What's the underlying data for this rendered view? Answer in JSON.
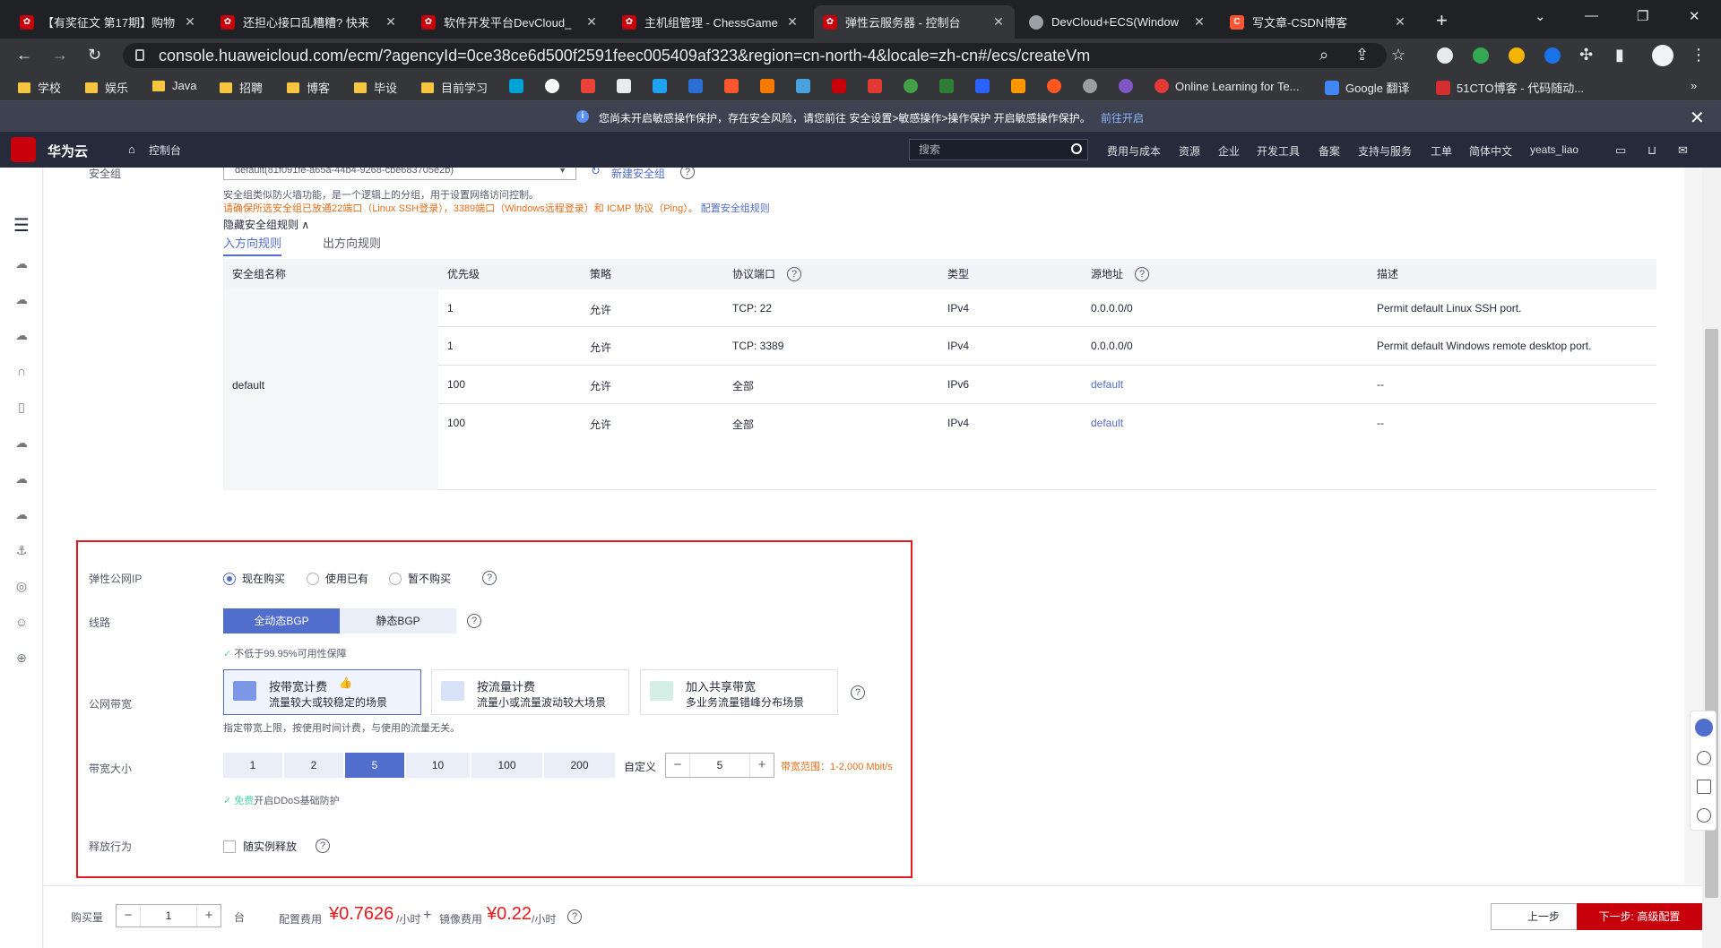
{
  "browser": {
    "tabs": [
      {
        "title": "【有奖征文 第17期】购物",
        "color": "#c7000b",
        "active": false
      },
      {
        "title": "还担心接口乱糟糟? 快来",
        "color": "#c7000b",
        "active": false
      },
      {
        "title": "软件开发平台DevCloud_",
        "color": "#c7000b",
        "active": false
      },
      {
        "title": "主机组管理 - ChessGame",
        "color": "#c7000b",
        "active": false
      },
      {
        "title": "弹性云服务器 - 控制台",
        "color": "#c7000b",
        "active": true
      },
      {
        "title": "DevCloud+ECS(Window",
        "color": "#9aa0a6",
        "active": false
      },
      {
        "title": "写文章-CSDN博客",
        "color": "#fc5531",
        "active": false
      }
    ],
    "url": "console.huaweicloud.com/ecm/?agencyId=0ce38ce6d500f2591feec005409af323&region=cn-north-4&locale=zh-cn#/ecs/createVm",
    "bookmarks": [
      "学校",
      "娱乐",
      "Java",
      "招聘",
      "博客",
      "毕设",
      "目前学习"
    ],
    "bookmark_links": [
      "Online Learning for Te...",
      "Google 翻译",
      "51CTO博客 - 代码随动..."
    ]
  },
  "banner": {
    "text": "您尚未开启敏感操作保护，存在安全风险，请您前往 安全设置>敏感操作>操作保护 开启敏感操作保护。",
    "link": "前往开启"
  },
  "topnav": {
    "brand": "华为云",
    "console": "控制台",
    "search_placeholder": "搜索",
    "items": [
      "费用与成本",
      "资源",
      "企业",
      "开发工具",
      "备案",
      "支持与服务",
      "工单",
      "简体中文",
      "yeats_liao"
    ]
  },
  "security_group": {
    "label": "安全组",
    "selected": "default(81f091fe-a65a-44b4-9268-cbe683705e2b)",
    "new_link": "新建安全组",
    "desc": "安全组类似防火墙功能，是一个逻辑上的分组，用于设置网络访问控制。",
    "warning": "请确保所选安全组已放通22端口（Linux SSH登录），3389端口（Windows远程登录）和 ICMP 协议（Ping）。",
    "config_link": "配置安全组规则",
    "hide_rules": "隐藏安全组规则",
    "tab_in": "入方向规则",
    "tab_out": "出方向规则",
    "columns": [
      "安全组名称",
      "优先级",
      "策略",
      "协议端口",
      "类型",
      "源地址",
      "描述"
    ],
    "group_name": "default",
    "rows": [
      {
        "priority": "1",
        "policy": "允许",
        "port": "TCP: 22",
        "type": "IPv4",
        "source": "0.0.0.0/0",
        "desc": "Permit default Linux SSH port."
      },
      {
        "priority": "1",
        "policy": "允许",
        "port": "TCP: 3389",
        "type": "IPv4",
        "source": "0.0.0.0/0",
        "desc": "Permit default Windows remote desktop port."
      },
      {
        "priority": "100",
        "policy": "允许",
        "port": "全部",
        "type": "IPv6",
        "source": "default",
        "desc": "--"
      },
      {
        "priority": "100",
        "policy": "允许",
        "port": "全部",
        "type": "IPv4",
        "source": "default",
        "desc": "--"
      }
    ]
  },
  "eip": {
    "label": "弹性公网IP",
    "options": [
      "现在购买",
      "使用已有",
      "暂不购买"
    ],
    "line_label": "线路",
    "line_options": [
      "全动态BGP",
      "静态BGP"
    ],
    "sla": "不低于99.95%可用性保障",
    "bandwidth_label": "公网带宽",
    "cards": [
      {
        "title": "按带宽计费",
        "sub": "流量较大或较稳定的场景"
      },
      {
        "title": "按流量计费",
        "sub": "流量小或流量波动较大场景"
      },
      {
        "title": "加入共享带宽",
        "sub": "多业务流量错峰分布场景"
      }
    ],
    "bandwidth_hint": "指定带宽上限，按使用时间计费，与使用的流量无关。",
    "size_label": "带宽大小",
    "sizes": [
      "1",
      "2",
      "5",
      "10",
      "100",
      "200"
    ],
    "custom_label": "自定义",
    "custom_value": "5",
    "range": "带宽范围：1-2,000 Mbit/s",
    "ddos_free": "免费",
    "ddos_text": "开启DDoS基础防护",
    "release_label": "释放行为",
    "release_option": "随实例释放"
  },
  "footer": {
    "qty_label": "购买量",
    "qty": "1",
    "unit": "台",
    "cost_label": "配置费用",
    "cost": "¥0.7626",
    "cost_unit": "/小时",
    "plus": "+",
    "image_label": "镜像费用",
    "image_cost": "¥0.22",
    "image_unit": "/小时",
    "prev": "上一步",
    "next": "下一步: 高级配置"
  }
}
